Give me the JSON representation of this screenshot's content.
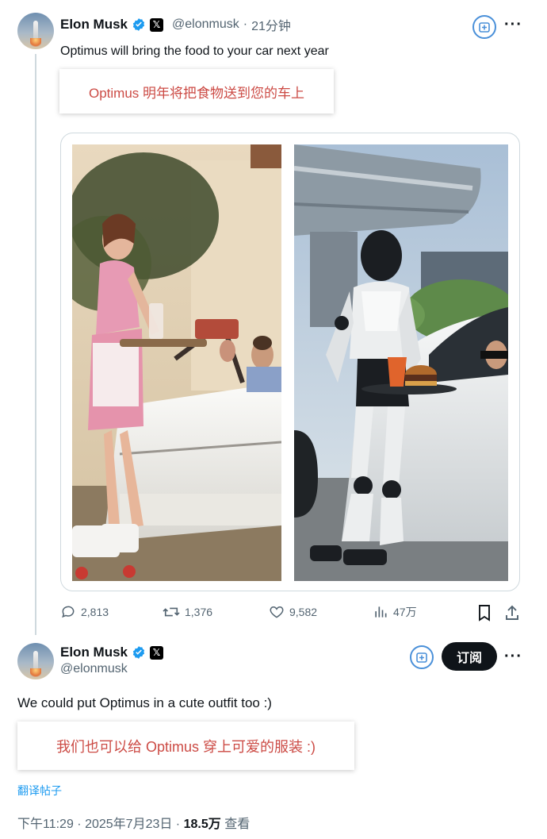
{
  "tweet1": {
    "author_name": "Elon Musk",
    "handle": "@elonmusk",
    "time": "21分钟",
    "text": "Optimus will bring the food to your car next year",
    "translation": "Optimus 明年将把食物送到您的车上",
    "actions": {
      "replies": "2,813",
      "retweets": "1,376",
      "likes": "9,582",
      "views": "47万"
    }
  },
  "tweet2": {
    "author_name": "Elon Musk",
    "handle": "@elonmusk",
    "subscribe_label": "订阅",
    "text": "We could put Optimus in a cute outfit too :)",
    "translation": "我们也可以给 Optimus 穿上可爱的服装 :)",
    "translate_link": "翻译帖子",
    "timestamp": "下午11:29 · 2025年7月23日 · ",
    "view_count": "18.5万",
    "views_label": " 查看"
  },
  "colors": {
    "accent_blue": "#1d9bf0",
    "translation_red": "#cc4b45",
    "text_primary": "#0f1419",
    "text_secondary": "#536471"
  }
}
